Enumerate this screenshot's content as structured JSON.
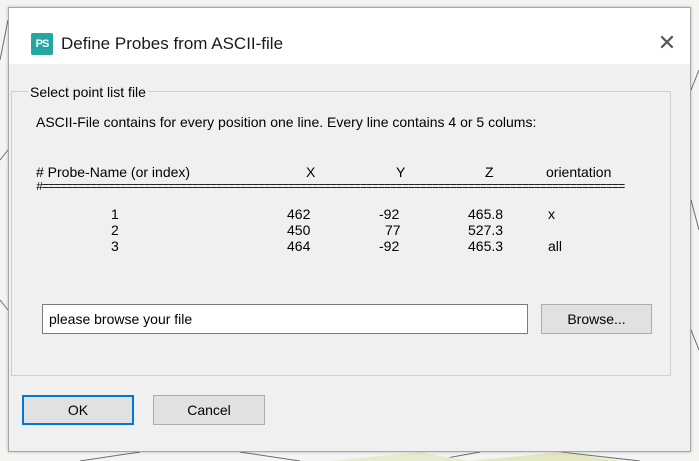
{
  "window": {
    "title": "Define Probes from ASCII-file",
    "icon_label": "PS",
    "close_glyph": "✕"
  },
  "group": {
    "label": "Select point list file",
    "description": "ASCII-File contains for every position one line. Every line contains 4 or 5 colums:"
  },
  "table": {
    "headers": [
      "# Probe-Name (or index)",
      "X",
      "Y",
      "Z",
      "orientation"
    ],
    "separator": "#=================================================================================================",
    "rows": [
      {
        "name": "1",
        "x": "462",
        "y": "-92",
        "z": "465.8",
        "orientation": "x"
      },
      {
        "name": "2",
        "x": "450",
        "y": "77",
        "z": "527.3",
        "orientation": ""
      },
      {
        "name": "3",
        "x": "464",
        "y": "-92",
        "z": "465.3",
        "orientation": "all"
      }
    ]
  },
  "file_input": {
    "value": "please browse your file"
  },
  "buttons": {
    "browse": "Browse...",
    "ok": "OK",
    "cancel": "Cancel"
  },
  "colors": {
    "accent": "#0078d7",
    "icon_bg": "#25a6a0"
  }
}
